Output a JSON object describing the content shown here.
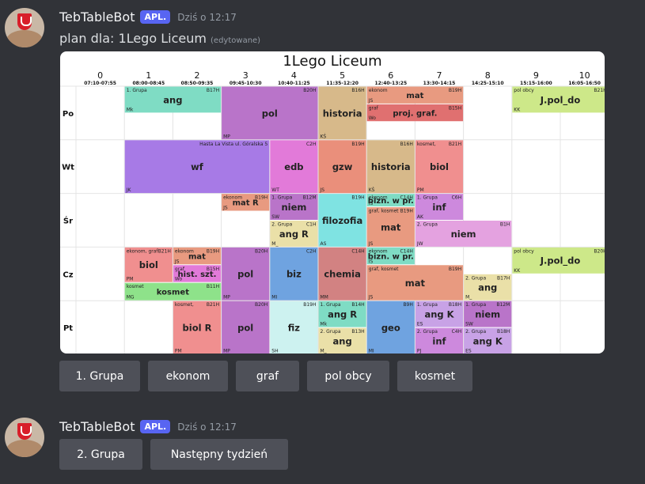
{
  "messages": [
    {
      "author": "TebTableBot",
      "badge": "APL.",
      "time": "Dziś o 12:17",
      "content": "plan dla: 1Lego Liceum",
      "edited": "(edytowane)",
      "buttons": [
        "1. Grupa",
        "ekonom",
        "graf",
        "pol obcy",
        "kosmet"
      ]
    },
    {
      "author": "TebTableBot",
      "badge": "APL.",
      "time": "Dziś o 12:17",
      "buttons": [
        "2. Grupa",
        "Następny tydzień"
      ]
    }
  ],
  "timetable": {
    "title": "1Lego Liceum",
    "periods": [
      {
        "n": "0",
        "t": "07:10-07:55"
      },
      {
        "n": "1",
        "t": "08:00-08:45"
      },
      {
        "n": "2",
        "t": "08:50-09:35"
      },
      {
        "n": "3",
        "t": "09:45-10:30"
      },
      {
        "n": "4",
        "t": "10:40-11:25"
      },
      {
        "n": "5",
        "t": "11:35-12:20"
      },
      {
        "n": "6",
        "t": "12:40-13:25"
      },
      {
        "n": "7",
        "t": "13:30-14:15"
      },
      {
        "n": "8",
        "t": "14:25-15:10"
      },
      {
        "n": "9",
        "t": "15:15-16:00"
      },
      {
        "n": "10",
        "t": "16:05-16:50"
      }
    ],
    "days": [
      "Po",
      "Wt",
      "Śr",
      "Cz",
      "Pt"
    ],
    "colors": {
      "teal": "#7fdcc4",
      "purple": "#b974c9",
      "tan": "#d7b98a",
      "salmon": "#e89a80",
      "red": "#e07070",
      "lime": "#cde889",
      "violet": "#a77ae6",
      "magenta": "#e27ad9",
      "peach": "#ea8f7b",
      "cyan": "#7fe3e2",
      "rose": "#f08f8f",
      "lilac": "#cd89dd",
      "pink": "#e4a2e0",
      "green": "#8ee28a",
      "blue": "#6fa3e0",
      "mint": "#cdf2f0",
      "sand": "#eae0a8",
      "lavender": "#c8a2e6",
      "chem": "#d28282"
    },
    "lessons": [
      {
        "d": 0,
        "p": 1,
        "span": 2,
        "r0": 0,
        "r1": 0.5,
        "c": "teal",
        "name": "ang",
        "tl": "1. Grupa",
        "tr": "B17H",
        "bl": "Mk"
      },
      {
        "d": 0,
        "p": 3,
        "span": 2,
        "r0": 0,
        "r1": 1,
        "c": "purple",
        "name": "pol",
        "tr": "B20H",
        "bl": "MP"
      },
      {
        "d": 0,
        "p": 5,
        "span": 1,
        "r0": 0,
        "r1": 1,
        "c": "tan",
        "name": "historia",
        "tr": "B16H",
        "bl": "KŚ"
      },
      {
        "d": 0,
        "p": 6,
        "span": 2,
        "r0": 0,
        "r1": 0.33,
        "c": "salmon",
        "name": "mat",
        "tl": "ekonom",
        "tr": "B19H",
        "bl": "JS"
      },
      {
        "d": 0,
        "p": 6,
        "span": 2,
        "r0": 0.33,
        "r1": 0.66,
        "c": "red",
        "name": "proj. graf.",
        "tl": "graf",
        "tr": "B15H",
        "bl": "Wo"
      },
      {
        "d": 0,
        "p": 9,
        "span": 2,
        "r0": 0,
        "r1": 0.5,
        "c": "lime",
        "name": "J.pol_do",
        "tl": "pol obcy",
        "tr": "B21H",
        "bl": "KK"
      },
      {
        "d": 1,
        "p": 1,
        "span": 3,
        "r0": 0,
        "r1": 1,
        "c": "violet",
        "name": "wf",
        "tr": "Hasta La Vista ul. Góralska 5",
        "bl": "JK"
      },
      {
        "d": 1,
        "p": 4,
        "span": 1,
        "r0": 0,
        "r1": 1,
        "c": "magenta",
        "name": "edb",
        "tr": "C2H",
        "bl": "WT"
      },
      {
        "d": 1,
        "p": 5,
        "span": 1,
        "r0": 0,
        "r1": 1,
        "c": "peach",
        "name": "gzw",
        "tr": "B19H",
        "bl": "JS"
      },
      {
        "d": 1,
        "p": 6,
        "span": 1,
        "r0": 0,
        "r1": 1,
        "c": "tan",
        "name": "historia",
        "tr": "B16H",
        "bl": "KŚ"
      },
      {
        "d": 1,
        "p": 7,
        "span": 1,
        "r0": 0,
        "r1": 1,
        "c": "rose",
        "name": "biol",
        "tl": "kosmet,",
        "tr": "B21H",
        "bl": "PM"
      },
      {
        "d": 2,
        "p": 3,
        "span": 1,
        "r0": 0,
        "r1": 0.33,
        "c": "salmon",
        "name": "mat R",
        "tl": "ekonom",
        "tr": "B19H",
        "bl": "JS"
      },
      {
        "d": 2,
        "p": 4,
        "span": 1,
        "r0": 0,
        "r1": 0.5,
        "c": "purple",
        "name": "niem",
        "tl": "1. Grupa",
        "tr": "B12M",
        "bl": "SW"
      },
      {
        "d": 2,
        "p": 4,
        "span": 1,
        "r0": 0.5,
        "r1": 1,
        "c": "sand",
        "name": "ang R",
        "tl": "2. Grupa",
        "tr": "C1H",
        "bl": "M_"
      },
      {
        "d": 2,
        "p": 5,
        "span": 1,
        "r0": 0,
        "r1": 1,
        "c": "cyan",
        "name": "filozofia",
        "tr": "B19H",
        "bl": "AS"
      },
      {
        "d": 2,
        "p": 6,
        "span": 1,
        "r0": 0,
        "r1": 0.25,
        "c": "teal",
        "name": "bizn. w pr.",
        "tl": "ekonom",
        "tr": "C14H",
        "bl": "IS"
      },
      {
        "d": 2,
        "p": 6,
        "span": 1,
        "r0": 0.25,
        "r1": 1,
        "c": "salmon",
        "name": "mat",
        "tl": "graf, kosmet",
        "tr": "B19H",
        "bl": "JS"
      },
      {
        "d": 2,
        "p": 7,
        "span": 1,
        "r0": 0,
        "r1": 0.5,
        "c": "lilac",
        "name": "inf",
        "tl": "1. Grupa",
        "tr": "C6H",
        "bl": "AK"
      },
      {
        "d": 2,
        "p": 7,
        "span": 2,
        "r0": 0.5,
        "r1": 1,
        "c": "pink",
        "name": "niem",
        "tl": "2. Grupa",
        "tr": "B1H",
        "bl": "JW"
      },
      {
        "d": 3,
        "p": 1,
        "span": 1,
        "r0": 0,
        "r1": 0.66,
        "c": "rose",
        "name": "biol",
        "tl": "ekonom, graf",
        "tr": "B21H",
        "bl": "PM"
      },
      {
        "d": 3,
        "p": 2,
        "span": 1,
        "r0": 0,
        "r1": 0.33,
        "c": "salmon",
        "name": "mat",
        "tl": "ekonom",
        "tr": "B19H",
        "bl": "JS"
      },
      {
        "d": 3,
        "p": 2,
        "span": 1,
        "r0": 0.33,
        "r1": 0.66,
        "c": "magenta",
        "name": "hist. szt.",
        "tl": "graf",
        "tr": "B15H",
        "bl": "Wo"
      },
      {
        "d": 3,
        "p": 1,
        "span": 2,
        "r0": 0.66,
        "r1": 1,
        "c": "green",
        "name": "kosmet",
        "tl": "kosmet",
        "tr": "B11H",
        "bl": "MG"
      },
      {
        "d": 3,
        "p": 3,
        "span": 1,
        "r0": 0,
        "r1": 1,
        "c": "purple",
        "name": "pol",
        "tr": "B20H",
        "bl": "MP"
      },
      {
        "d": 3,
        "p": 4,
        "span": 1,
        "r0": 0,
        "r1": 1,
        "c": "blue",
        "name": "biz",
        "tr": "C2H",
        "bl": "MI"
      },
      {
        "d": 3,
        "p": 5,
        "span": 1,
        "r0": 0,
        "r1": 1,
        "c": "chem",
        "name": "chemia",
        "tr": "C14H",
        "bl": "MM"
      },
      {
        "d": 3,
        "p": 6,
        "span": 1,
        "r0": 0,
        "r1": 0.33,
        "c": "teal",
        "name": "bizn. w pr.",
        "tl": "ekonom",
        "tr": "C14H",
        "bl": "IS"
      },
      {
        "d": 3,
        "p": 6,
        "span": 2,
        "r0": 0.33,
        "r1": 1,
        "c": "salmon",
        "name": "mat",
        "tl": "graf, kosmet",
        "tr": "B19H",
        "bl": "JS"
      },
      {
        "d": 3,
        "p": 8,
        "span": 1,
        "r0": 0.5,
        "r1": 1,
        "c": "sand",
        "name": "ang",
        "tl": "2. Grupa",
        "tr": "B17H",
        "bl": "M_"
      },
      {
        "d": 3,
        "p": 9,
        "span": 2,
        "r0": 0,
        "r1": 0.5,
        "c": "lime",
        "name": "J.pol_do",
        "tl": "pol obcy",
        "tr": "B20H",
        "bl": "KK"
      },
      {
        "d": 4,
        "p": 2,
        "span": 1,
        "r0": 0,
        "r1": 1,
        "c": "rose",
        "name": "biol R",
        "tl": "kosmet,",
        "tr": "B21H",
        "bl": "PM"
      },
      {
        "d": 4,
        "p": 3,
        "span": 1,
        "r0": 0,
        "r1": 1,
        "c": "purple",
        "name": "pol",
        "tr": "B20H",
        "bl": "MP"
      },
      {
        "d": 4,
        "p": 4,
        "span": 1,
        "r0": 0,
        "r1": 1,
        "c": "mint",
        "name": "fiz",
        "tr": "B19H",
        "bl": "SH"
      },
      {
        "d": 4,
        "p": 5,
        "span": 1,
        "r0": 0,
        "r1": 0.5,
        "c": "teal",
        "name": "ang R",
        "tl": "1. Grupa",
        "tr": "B14H",
        "bl": "Mk"
      },
      {
        "d": 4,
        "p": 5,
        "span": 1,
        "r0": 0.5,
        "r1": 1,
        "c": "sand",
        "name": "ang",
        "tl": "2. Grupa",
        "tr": "B13H",
        "bl": "M_"
      },
      {
        "d": 4,
        "p": 6,
        "span": 1,
        "r0": 0,
        "r1": 1,
        "c": "blue",
        "name": "geo",
        "tr": "B9H",
        "bl": "MI"
      },
      {
        "d": 4,
        "p": 7,
        "span": 1,
        "r0": 0,
        "r1": 0.5,
        "c": "lavender",
        "name": "ang K",
        "tl": "1. Grupa",
        "tr": "B18H",
        "bl": "ES"
      },
      {
        "d": 4,
        "p": 7,
        "span": 1,
        "r0": 0.5,
        "r1": 1,
        "c": "lilac",
        "name": "inf",
        "tl": "2. Grupa",
        "tr": "C4H",
        "bl": "PJ"
      },
      {
        "d": 4,
        "p": 8,
        "span": 1,
        "r0": 0,
        "r1": 0.5,
        "c": "purple",
        "name": "niem",
        "tl": "1. Grupa",
        "tr": "B12M",
        "bl": "SW"
      },
      {
        "d": 4,
        "p": 8,
        "span": 1,
        "r0": 0.5,
        "r1": 1,
        "c": "lavender",
        "name": "ang K",
        "tl": "2. Grupa",
        "tr": "B18H",
        "bl": "ES"
      }
    ]
  }
}
